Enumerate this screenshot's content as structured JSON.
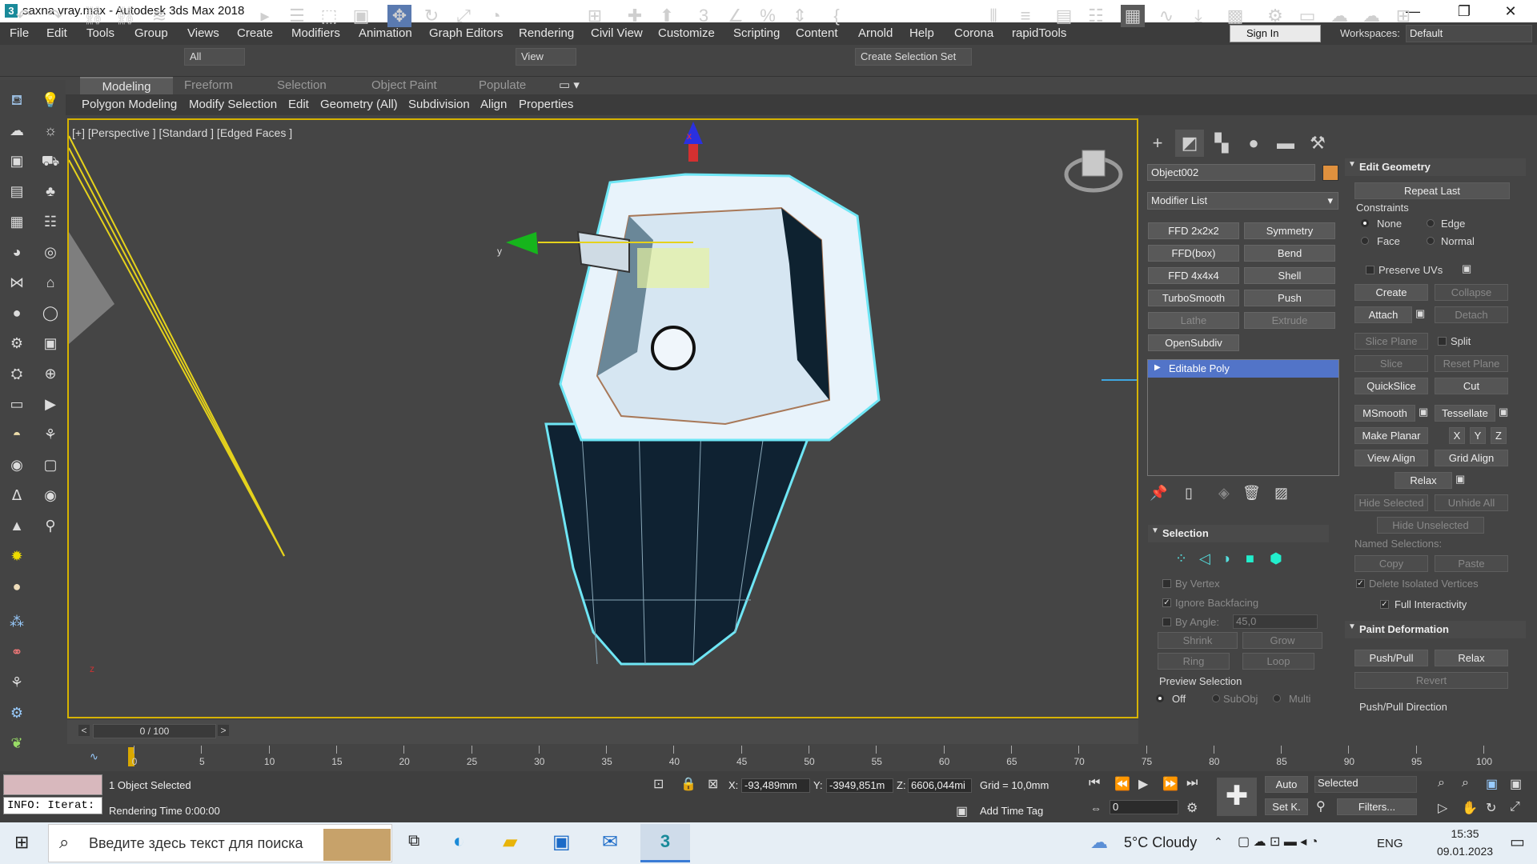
{
  "window": {
    "title": "saxna vray.max - Autodesk 3ds Max 2018",
    "app_icon": "3",
    "minimize": "—",
    "maximize": "❐",
    "close": "✕"
  },
  "menu": [
    "File",
    "Edit",
    "Tools",
    "Group",
    "Views",
    "Create",
    "Modifiers",
    "Animation",
    "Graph Editors",
    "Rendering",
    "Civil View",
    "Customize",
    "Scripting",
    "Content",
    "Arnold",
    "Help",
    "Corona",
    "rapidTools"
  ],
  "signin": "Sign In",
  "workspaces": {
    "label": "Workspaces:",
    "value": "Default"
  },
  "toolbar": {
    "filter": "All",
    "view": "View",
    "selection_set": "Create Selection Set"
  },
  "ribbon": {
    "tabs": [
      "Modeling",
      "Freeform",
      "Selection",
      "Object Paint",
      "Populate"
    ],
    "sub": [
      "Polygon Modeling",
      "Modify Selection",
      "Edit",
      "Geometry (All)",
      "Subdivision",
      "Align",
      "Properties"
    ]
  },
  "viewport": {
    "label": "[+] [Perspective ] [Standard ] [Edged Faces ]",
    "axis_x": "x",
    "axis_y": "y",
    "axis_z": "z"
  },
  "panel": {
    "object_name": "Object002",
    "object_color": "#e0913e",
    "modifier_list": "Modifier List",
    "modifiers": [
      {
        "label": "FFD 2x2x2",
        "enabled": true
      },
      {
        "label": "Symmetry",
        "enabled": true
      },
      {
        "label": "FFD(box)",
        "enabled": true
      },
      {
        "label": "Bend",
        "enabled": true
      },
      {
        "label": "FFD 4x4x4",
        "enabled": true
      },
      {
        "label": "Shell",
        "enabled": true
      },
      {
        "label": "TurboSmooth",
        "enabled": true
      },
      {
        "label": "Push",
        "enabled": true
      },
      {
        "label": "Lathe",
        "enabled": false
      },
      {
        "label": "Extrude",
        "enabled": false
      },
      {
        "label": "OpenSubdiv",
        "enabled": true
      }
    ],
    "stack_item": "Editable Poly",
    "selection": {
      "title": "Selection",
      "by_vertex": "By Vertex",
      "ignore_backfacing": "Ignore Backfacing",
      "by_angle": "By Angle:",
      "angle_value": "45,0",
      "shrink": "Shrink",
      "grow": "Grow",
      "ring": "Ring",
      "loop": "Loop",
      "preview": "Preview Selection",
      "preview_off": "Off",
      "preview_subobj": "SubObj",
      "preview_multi": "Multi"
    },
    "edit_geometry": {
      "title": "Edit Geometry",
      "repeat_last": "Repeat Last",
      "constraints": "Constraints",
      "none": "None",
      "edge": "Edge",
      "face": "Face",
      "normal": "Normal",
      "preserve_uvs": "Preserve UVs",
      "create": "Create",
      "collapse": "Collapse",
      "attach": "Attach",
      "detach": "Detach",
      "slice_plane": "Slice Plane",
      "split": "Split",
      "slice": "Slice",
      "reset_plane": "Reset Plane",
      "quickslice": "QuickSlice",
      "cut": "Cut",
      "msmooth": "MSmooth",
      "tessellate": "Tessellate",
      "make_planar": "Make Planar",
      "x": "X",
      "y": "Y",
      "z": "Z",
      "view_align": "View Align",
      "grid_align": "Grid Align",
      "relax": "Relax",
      "hide_selected": "Hide Selected",
      "unhide_all": "Unhide All",
      "hide_unselected": "Hide Unselected",
      "named_selections": "Named Selections:",
      "copy": "Copy",
      "paste": "Paste",
      "delete_isolated": "Delete Isolated Vertices",
      "full_interactivity": "Full Interactivity"
    },
    "paint_deformation": {
      "title": "Paint Deformation",
      "push_pull": "Push/Pull",
      "relax": "Relax",
      "revert": "Revert",
      "direction": "Push/Pull Direction"
    }
  },
  "timeline": {
    "frame": "0 / 100",
    "ticks": [
      "0",
      "5",
      "10",
      "15",
      "20",
      "25",
      "30",
      "35",
      "40",
      "45",
      "50",
      "55",
      "60",
      "65",
      "70",
      "75",
      "80",
      "85",
      "90",
      "95",
      "100"
    ]
  },
  "status": {
    "maxscript": "INFO: Iterat:",
    "selected": "1 Object Selected",
    "render_time": "Rendering Time  0:00:00",
    "x_label": "X:",
    "x": "-93,489mm",
    "y_label": "Y:",
    "y": "-3949,851m",
    "z_label": "Z:",
    "z": "6606,044mi",
    "grid": "Grid = 10,0mm",
    "add_time_tag": "Add Time Tag",
    "frame_value": "0",
    "auto": "Auto",
    "set_key": "Set K.",
    "key_filter": "Selected",
    "filters": "Filters..."
  },
  "taskbar": {
    "search": "Введите здесь текст для поиска",
    "weather": "5°C  Cloudy",
    "lang": "ENG",
    "time": "15:35",
    "date": "09.01.2023"
  }
}
